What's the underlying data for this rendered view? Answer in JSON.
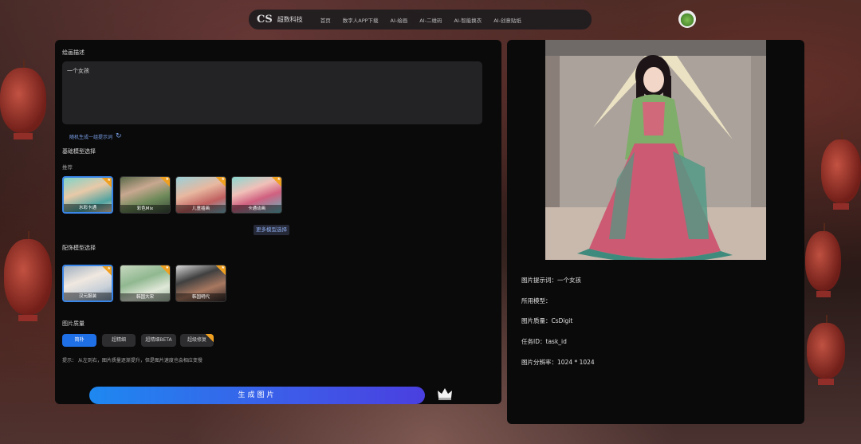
{
  "nav": {
    "logo": "CS",
    "brand": "超数科技",
    "links": [
      "首页",
      "数字人APP下载",
      "AI-绘画",
      "AI-二维码",
      "AI-智能换衣",
      "AI-创意贴纸"
    ]
  },
  "left": {
    "prompt_title": "绘画描述",
    "prompt_value": "一个女孩",
    "random_link": "随机生成一组提示词",
    "base_model_title": "基础模型选择",
    "recommend_label": "推荐",
    "base_models": [
      {
        "label": "水彩卡通",
        "active": true,
        "badge": true
      },
      {
        "label": "彩色Mix",
        "active": false,
        "badge": true
      },
      {
        "label": "儿童插画",
        "active": false,
        "badge": true
      },
      {
        "label": "卡通动画",
        "active": false,
        "badge": true
      }
    ],
    "more_models": "更多模型选择",
    "aux_model_title": "配饰模型选择",
    "aux_models": [
      {
        "label": "汉元服装",
        "active": true,
        "badge": true
      },
      {
        "label": "韩国大宋",
        "active": false,
        "badge": true
      },
      {
        "label": "韩国明代",
        "active": false,
        "badge": true
      }
    ],
    "quality_title": "图片质量",
    "quality_options": [
      {
        "label": "简朴",
        "active": true,
        "badge": false
      },
      {
        "label": "超精细",
        "active": false,
        "badge": false
      },
      {
        "label": "超精细BETA",
        "active": false,
        "badge": false
      },
      {
        "label": "超级修复",
        "active": false,
        "badge": true
      }
    ],
    "hint": "提示：  从左到右，图片质量逐渐提升，但是图片速度也会相应变慢",
    "generate_button": "生成图片"
  },
  "right": {
    "info": [
      {
        "key": "图片提示词：",
        "value": "一个女孩"
      },
      {
        "key": "所用模型：",
        "value": ""
      },
      {
        "key": "图片质量：",
        "value": "CsDigit"
      },
      {
        "key": "任务ID：",
        "value": "task_id"
      },
      {
        "key": "图片分辨率：",
        "value": "1024 * 1024"
      }
    ]
  },
  "colors": {
    "accent": "#1f6fe6",
    "panel": "#0a0a0b",
    "badge": "#f0a020"
  }
}
